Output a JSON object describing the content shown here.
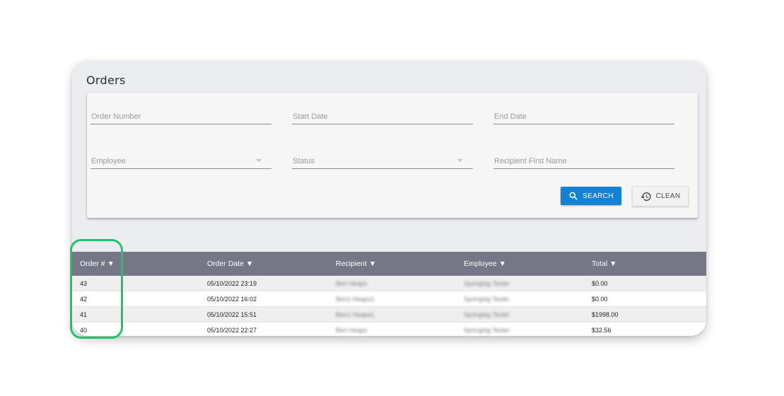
{
  "page": {
    "title": "Orders"
  },
  "filters": {
    "order_number": "Order Number",
    "start_date": "Start Date",
    "end_date": "End Date",
    "employee": "Employee",
    "status": "Status",
    "recipient_first_name": "Recipient First Name"
  },
  "buttons": {
    "search": "SEARCH",
    "clean": "CLEAN"
  },
  "table": {
    "headers": [
      "Order # ▼",
      "Order Date ▼",
      "Recipient ▼",
      "Employee ▼",
      "Total ▼"
    ],
    "rows": [
      [
        "43",
        "05/10/2022 23:19",
        "Ben Heaps",
        "Springbig Tester",
        "$0.00"
      ],
      [
        "42",
        "05/10/2022 16:02",
        "Ben1 Heaps1",
        "Springbig Tester",
        "$0.00"
      ],
      [
        "41",
        "05/10/2022 15:51",
        "Ben1 Heaps1",
        "Springbig Tester",
        "$1998.00"
      ],
      [
        "40",
        "05/10/2022 22:27",
        "Ben Heaps",
        "Springbig Tester",
        "$32.56"
      ]
    ]
  },
  "colors": {
    "header_bg": "#757786",
    "search_btn": "#1581d3",
    "highlight": "#1ec36e"
  },
  "icons": {
    "search": "search-icon",
    "clean": "history-icon"
  }
}
